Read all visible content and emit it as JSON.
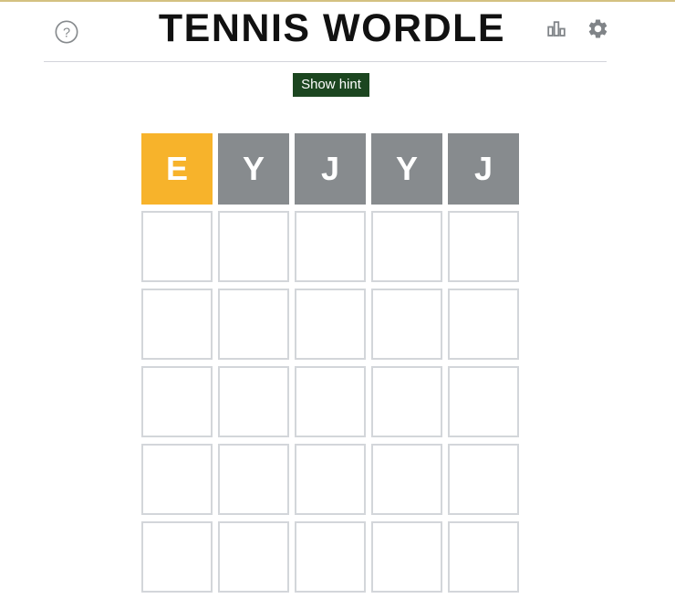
{
  "page": {
    "title": "TENNIS WORDLE",
    "top_accent_color": "#d4c181",
    "background": "#ffffff"
  },
  "header": {
    "title": "TENNIS WORDLE",
    "help_icon": "question-circle-icon",
    "stats_icon": "bar-chart-icon",
    "settings_icon": "gear-icon",
    "icon_color": "#808488",
    "divider_color": "#d3d4da"
  },
  "toolbar": {
    "hint_label": "Show hint",
    "hint_bg": "#1c4620",
    "hint_text_color": "#ffffff"
  },
  "board": {
    "rows": 6,
    "columns": 5,
    "colors": {
      "present": "#f7b32b",
      "absent": "#878b8e",
      "empty_border": "#d3d6da",
      "letter": "#ffffff"
    },
    "tiles": [
      [
        {
          "letter": "E",
          "state": "present"
        },
        {
          "letter": "Y",
          "state": "absent"
        },
        {
          "letter": "J",
          "state": "absent"
        },
        {
          "letter": "Y",
          "state": "absent"
        },
        {
          "letter": "J",
          "state": "absent"
        }
      ],
      [
        {
          "letter": "",
          "state": "empty"
        },
        {
          "letter": "",
          "state": "empty"
        },
        {
          "letter": "",
          "state": "empty"
        },
        {
          "letter": "",
          "state": "empty"
        },
        {
          "letter": "",
          "state": "empty"
        }
      ],
      [
        {
          "letter": "",
          "state": "empty"
        },
        {
          "letter": "",
          "state": "empty"
        },
        {
          "letter": "",
          "state": "empty"
        },
        {
          "letter": "",
          "state": "empty"
        },
        {
          "letter": "",
          "state": "empty"
        }
      ],
      [
        {
          "letter": "",
          "state": "empty"
        },
        {
          "letter": "",
          "state": "empty"
        },
        {
          "letter": "",
          "state": "empty"
        },
        {
          "letter": "",
          "state": "empty"
        },
        {
          "letter": "",
          "state": "empty"
        }
      ],
      [
        {
          "letter": "",
          "state": "empty"
        },
        {
          "letter": "",
          "state": "empty"
        },
        {
          "letter": "",
          "state": "empty"
        },
        {
          "letter": "",
          "state": "empty"
        },
        {
          "letter": "",
          "state": "empty"
        }
      ],
      [
        {
          "letter": "",
          "state": "empty"
        },
        {
          "letter": "",
          "state": "empty"
        },
        {
          "letter": "",
          "state": "empty"
        },
        {
          "letter": "",
          "state": "empty"
        },
        {
          "letter": "",
          "state": "empty"
        }
      ]
    ]
  }
}
